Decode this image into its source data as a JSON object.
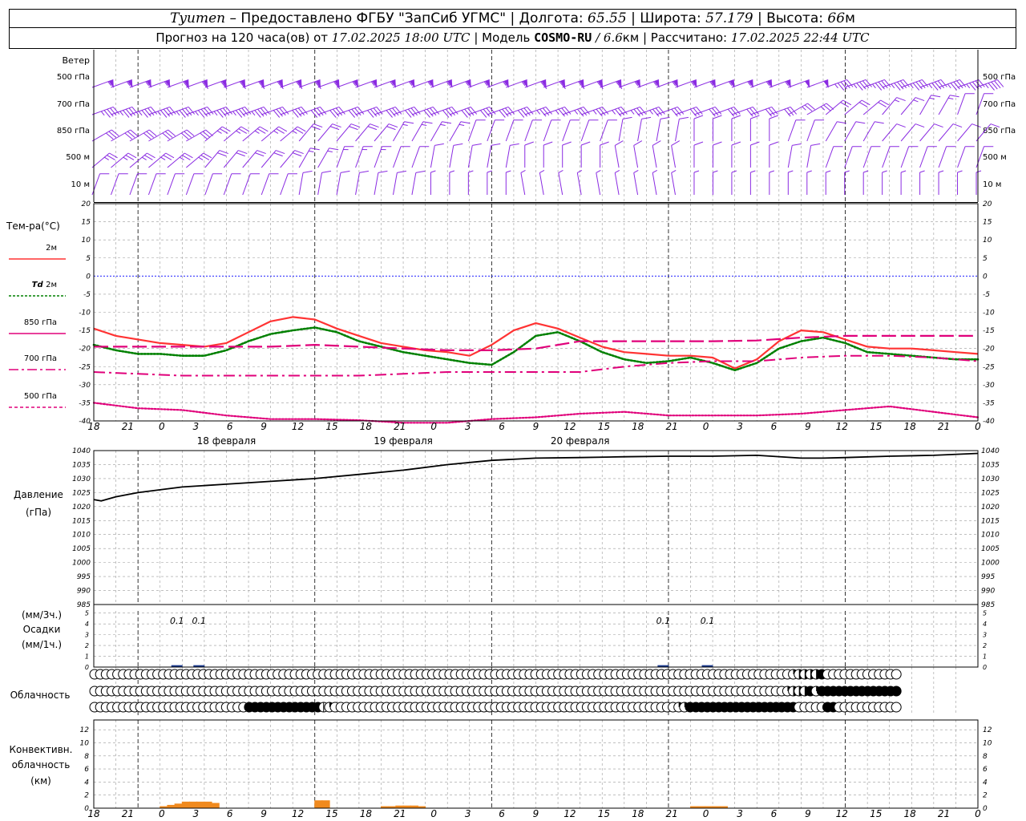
{
  "header": {
    "station": "Tyumen",
    "provider": "– Предоставлено ФГБУ \"ЗапСиб УГМС\" |",
    "lon_label": "Долгота:",
    "lon_value": "65.55",
    "lat_label": "| Широта:",
    "lat_value": "57.179",
    "alt_label": "| Высота:",
    "alt_value": "66",
    "alt_unit": "м",
    "forecast_label": "Прогноз на 120 часа(ов) от",
    "forecast_start": "17.02.2025 18:00 UTC",
    "model_label": "| Модель",
    "model_name": "COSMO-RU",
    "model_res": "/ 6.6",
    "model_res_unit": "км",
    "calc_label": "| Рассчитано:",
    "calc_time": "17.02.2025 22:44 UTC"
  },
  "wind_panel": {
    "title": "Ветер",
    "levels": [
      "500 гПа",
      "700 гПа",
      "850 гПа",
      "500 м",
      "10 м"
    ]
  },
  "temp_panel": {
    "title": "Тем-ра(°C)",
    "legend": [
      {
        "label": "2м",
        "label_italic": "",
        "color": "#ff3333",
        "dash": "solid"
      },
      {
        "label": "2м",
        "label_italic": "Td",
        "color": "#008000",
        "dash": "dotted"
      },
      {
        "label": "850 гПа",
        "label_italic": "",
        "color": "#e0007a",
        "dash": "solid"
      },
      {
        "label": "700 гПа",
        "label_italic": "",
        "color": "#e0007a",
        "dash": "dashdot"
      },
      {
        "label": "500 гПа",
        "label_italic": "",
        "color": "#e0007a",
        "dash": "dashed"
      }
    ]
  },
  "pressure_panel": {
    "title": "Давление",
    "unit": "(гПа)"
  },
  "precip_panel": {
    "unit3": "(мм/3ч.)",
    "title": "Осадки",
    "unit1": "(мм/1ч.)",
    "labels": [
      {
        "hour": 9,
        "text": "0.1"
      },
      {
        "hour": 12,
        "text": "0.1"
      },
      {
        "hour": 75,
        "text": "0.1"
      },
      {
        "hour": 81,
        "text": "0.1"
      }
    ]
  },
  "cloud_panel": {
    "title": "Облачность",
    "rows": [
      "000000000000000000000000000000000000000000000000000000000000000000000000000000000000000000000000000000000000000000000000002333340000000000000",
      "000000000000000000000000000000000000000000000000000000000000000000000000000000000000000000000000000000000000000000000000023334244444444444444",
      "000000000000000000000000000444444444444412000000000000000000000000000000000000000000000000000000000000224444444444444444444000004400000000000"
    ]
  },
  "conv_panel": {
    "title1": "Конвективн.",
    "title2": "облачность",
    "unit": "(км)"
  },
  "axis": {
    "hour_labels": [
      "18",
      "21",
      "0",
      "3",
      "6",
      "9",
      "12",
      "15",
      "18",
      "21",
      "0",
      "3",
      "6",
      "9",
      "12",
      "15",
      "18",
      "21",
      "0",
      "3",
      "6",
      "9",
      "12",
      "15",
      "18",
      "21",
      "0"
    ],
    "day_labels": [
      {
        "hour": 18,
        "text": "18 февраля"
      },
      {
        "hour": 42,
        "text": "19 февраля"
      },
      {
        "hour": 66,
        "text": "20 февраля"
      }
    ]
  },
  "chart_data": [
    {
      "type": "line",
      "title": "Тем-ра(°C)",
      "x_unit": "hours from 17.02.2025 18:00 UTC",
      "ylim": [
        -40,
        20
      ],
      "yticks": [
        20,
        15,
        10,
        5,
        0,
        -5,
        -10,
        -15,
        -20,
        -25,
        -30,
        -35,
        -40
      ],
      "zero_line_color": "#0000ff",
      "series": [
        {
          "name": "2м",
          "color": "#ff3333",
          "dash": "solid",
          "x": [
            0,
            3,
            6,
            9,
            12,
            15,
            18,
            21,
            24,
            27,
            30,
            33,
            36,
            39,
            42,
            45,
            48,
            51,
            54,
            57,
            60,
            63,
            66,
            69,
            72,
            75,
            78,
            81,
            84,
            87,
            90,
            93,
            96,
            99,
            102,
            105,
            108,
            111,
            114,
            117,
            120
          ],
          "y": [
            -14.5,
            -16.5,
            -17.5,
            -18.5,
            -19,
            -19.5,
            -18.5,
            -15.5,
            -12.5,
            -11.3,
            -12,
            -14.5,
            -16.5,
            -18.5,
            -19.5,
            -20.5,
            -21,
            -22,
            -19,
            -15,
            -13,
            -14.5,
            -17,
            -19.5,
            -21,
            -21.5,
            -22,
            -22,
            -22.5,
            -25.5,
            -23,
            -18,
            -15,
            -15.5,
            -17.5,
            -19.5,
            -20,
            -20,
            -20.5,
            -21,
            -21.5
          ]
        },
        {
          "name": "2м",
          "color": "#008000",
          "dash": "dotted",
          "x": [
            0,
            3,
            6,
            9,
            12,
            15,
            18,
            21,
            24,
            27,
            30,
            33,
            36,
            39,
            42,
            45,
            48,
            51,
            54,
            57,
            60,
            63,
            66,
            69,
            72,
            75,
            78,
            81,
            84,
            87,
            90,
            93,
            96,
            99,
            102,
            105,
            108,
            111,
            114,
            117,
            120
          ],
          "y": [
            -19,
            -20.5,
            -21.5,
            -21.5,
            -22,
            -22,
            -20.5,
            -18,
            -16,
            -15,
            -14.2,
            -15.5,
            -18,
            -19.5,
            -21,
            -22,
            -23,
            -24,
            -24.5,
            -21,
            -16.5,
            -15.5,
            -18,
            -21,
            -23,
            -24,
            -23.5,
            -22.5,
            -24,
            -26,
            -24,
            -20,
            -18,
            -17,
            -18.5,
            -21,
            -21.5,
            -22,
            -22.5,
            -23,
            -23
          ]
        },
        {
          "name": "850 гПа",
          "color": "#e0007a",
          "dash": "longdash",
          "x": [
            0,
            6,
            12,
            18,
            24,
            30,
            36,
            42,
            48,
            54,
            60,
            66,
            72,
            78,
            84,
            90,
            96,
            102,
            108,
            114,
            120
          ],
          "y": [
            -19.5,
            -19.5,
            -19.5,
            -19.5,
            -19.5,
            -19,
            -19.5,
            -20,
            -20.5,
            -20.5,
            -20,
            -18,
            -18,
            -18,
            -18,
            -17.8,
            -17,
            -16.5,
            -16.5,
            -16.5,
            -16.5
          ]
        },
        {
          "name": "700 гПа",
          "color": "#e0007a",
          "dash": "dashdot",
          "x": [
            0,
            6,
            12,
            18,
            24,
            30,
            36,
            42,
            48,
            54,
            60,
            66,
            72,
            78,
            84,
            90,
            96,
            102,
            108,
            114,
            120
          ],
          "y": [
            -26.5,
            -27,
            -27.5,
            -27.5,
            -27.5,
            -27.5,
            -27.5,
            -27,
            -26.5,
            -26.5,
            -26.5,
            -26.5,
            -25,
            -24,
            -23.5,
            -23.5,
            -22.5,
            -22,
            -22,
            -22.5,
            -23.5
          ]
        },
        {
          "name": "500 гПа",
          "color": "#e0007a",
          "dash": "dotted",
          "x": [
            0,
            6,
            12,
            18,
            24,
            30,
            36,
            42,
            48,
            54,
            60,
            66,
            72,
            78,
            84,
            90,
            96,
            102,
            108,
            114,
            120
          ],
          "y": [
            -35,
            -36.5,
            -37,
            -38.5,
            -39.5,
            -39.5,
            -39.8,
            -40.5,
            -40.5,
            -39.5,
            -39,
            -38,
            -37.5,
            -38.5,
            -38.5,
            -38.5,
            -38,
            -37,
            -36,
            -37.5,
            -39
          ]
        }
      ]
    },
    {
      "type": "line",
      "title": "Давление",
      "unit": "гПа",
      "ylim": [
        985,
        1040
      ],
      "yticks": [
        1040,
        1035,
        1030,
        1025,
        1020,
        1015,
        1010,
        1005,
        1000,
        995,
        990,
        985
      ],
      "series": [
        {
          "name": "Давление",
          "color": "#000000",
          "x": [
            0,
            1,
            3,
            6,
            9,
            12,
            18,
            24,
            30,
            36,
            42,
            48,
            54,
            60,
            66,
            72,
            78,
            84,
            90,
            96,
            99,
            102,
            108,
            114,
            120
          ],
          "y": [
            1022.5,
            1022,
            1023.5,
            1025,
            1026,
            1027,
            1028,
            1029,
            1030,
            1031.5,
            1033,
            1035,
            1036.5,
            1037.3,
            1037.5,
            1037.8,
            1038,
            1038,
            1038.3,
            1037.3,
            1037.3,
            1037.5,
            1038,
            1038.3,
            1039
          ]
        }
      ]
    },
    {
      "type": "bar",
      "title": "Осадки",
      "unit": "мм/3ч.",
      "ylim": [
        0,
        5
      ],
      "yticks": [
        0,
        1,
        2,
        3,
        4,
        5
      ],
      "series": [
        {
          "name": "Осадки",
          "color": "#1a3a8f",
          "x": [
            9,
            12,
            75,
            81
          ],
          "values": [
            0.1,
            0.1,
            0.1,
            0.1
          ]
        }
      ]
    },
    {
      "type": "bar",
      "title": "Конвективн. облачность",
      "unit": "км",
      "ylim": [
        0,
        13
      ],
      "yticks": [
        0,
        2,
        4,
        6,
        8,
        10,
        12
      ],
      "series": [
        {
          "name": "Конвективн. облачность",
          "color": "#f08a1e",
          "x": [
            9,
            10,
            11,
            12,
            13,
            14,
            15,
            16,
            30,
            31,
            39,
            40,
            41,
            42,
            43,
            44,
            81,
            82,
            83,
            84,
            85
          ],
          "values": [
            0.3,
            0.5,
            0.7,
            1.0,
            1.0,
            1.0,
            1.0,
            0.8,
            1.2,
            1.2,
            0.3,
            0.3,
            0.4,
            0.4,
            0.4,
            0.3,
            0.3,
            0.3,
            0.3,
            0.3,
            0.3
          ]
        }
      ]
    },
    {
      "type": "wind_barbs",
      "title": "Ветер",
      "unit": "knots",
      "levels": [
        "500 гПа",
        "700 гПа",
        "850 гПа",
        "500 м",
        "10 м"
      ],
      "x_hours": [
        0,
        6,
        12,
        18,
        24,
        30,
        36,
        42,
        48,
        54,
        60,
        66,
        72,
        78,
        84,
        90,
        96,
        102,
        108,
        114,
        120
      ],
      "speed": [
        [
          55,
          55,
          60,
          60,
          60,
          60,
          55,
          55,
          55,
          55,
          60,
          60,
          55,
          55,
          55,
          55,
          50,
          45,
          45,
          45,
          45
        ],
        [
          45,
          45,
          45,
          45,
          40,
          40,
          40,
          40,
          40,
          40,
          35,
          35,
          35,
          30,
          30,
          30,
          25,
          20,
          15,
          15,
          10
        ],
        [
          30,
          30,
          30,
          25,
          25,
          20,
          20,
          15,
          15,
          10,
          10,
          10,
          10,
          10,
          10,
          10,
          10,
          10,
          10,
          10,
          10
        ],
        [
          25,
          25,
          25,
          20,
          20,
          15,
          15,
          10,
          10,
          10,
          10,
          10,
          10,
          10,
          10,
          10,
          10,
          10,
          10,
          10,
          10
        ],
        [
          10,
          10,
          10,
          10,
          10,
          10,
          10,
          10,
          5,
          5,
          5,
          5,
          5,
          5,
          5,
          5,
          5,
          5,
          5,
          5,
          5
        ]
      ],
      "direction_deg": [
        [
          250,
          250,
          250,
          250,
          250,
          250,
          250,
          250,
          250,
          250,
          250,
          250,
          250,
          250,
          250,
          250,
          250,
          250,
          250,
          250,
          250
        ],
        [
          250,
          250,
          250,
          250,
          250,
          250,
          250,
          250,
          250,
          250,
          250,
          250,
          250,
          250,
          250,
          250,
          240,
          230,
          220,
          210,
          200
        ],
        [
          240,
          240,
          240,
          230,
          230,
          220,
          220,
          210,
          210,
          200,
          200,
          200,
          190,
          190,
          180,
          180,
          200,
          210,
          220,
          220,
          220
        ],
        [
          230,
          230,
          230,
          220,
          220,
          210,
          200,
          200,
          190,
          190,
          180,
          180,
          170,
          170,
          180,
          180,
          190,
          200,
          200,
          200,
          200
        ],
        [
          200,
          200,
          200,
          200,
          200,
          190,
          190,
          190,
          180,
          180,
          170,
          170,
          170,
          170,
          180,
          180,
          180,
          180,
          180,
          180,
          180
        ]
      ]
    }
  ]
}
